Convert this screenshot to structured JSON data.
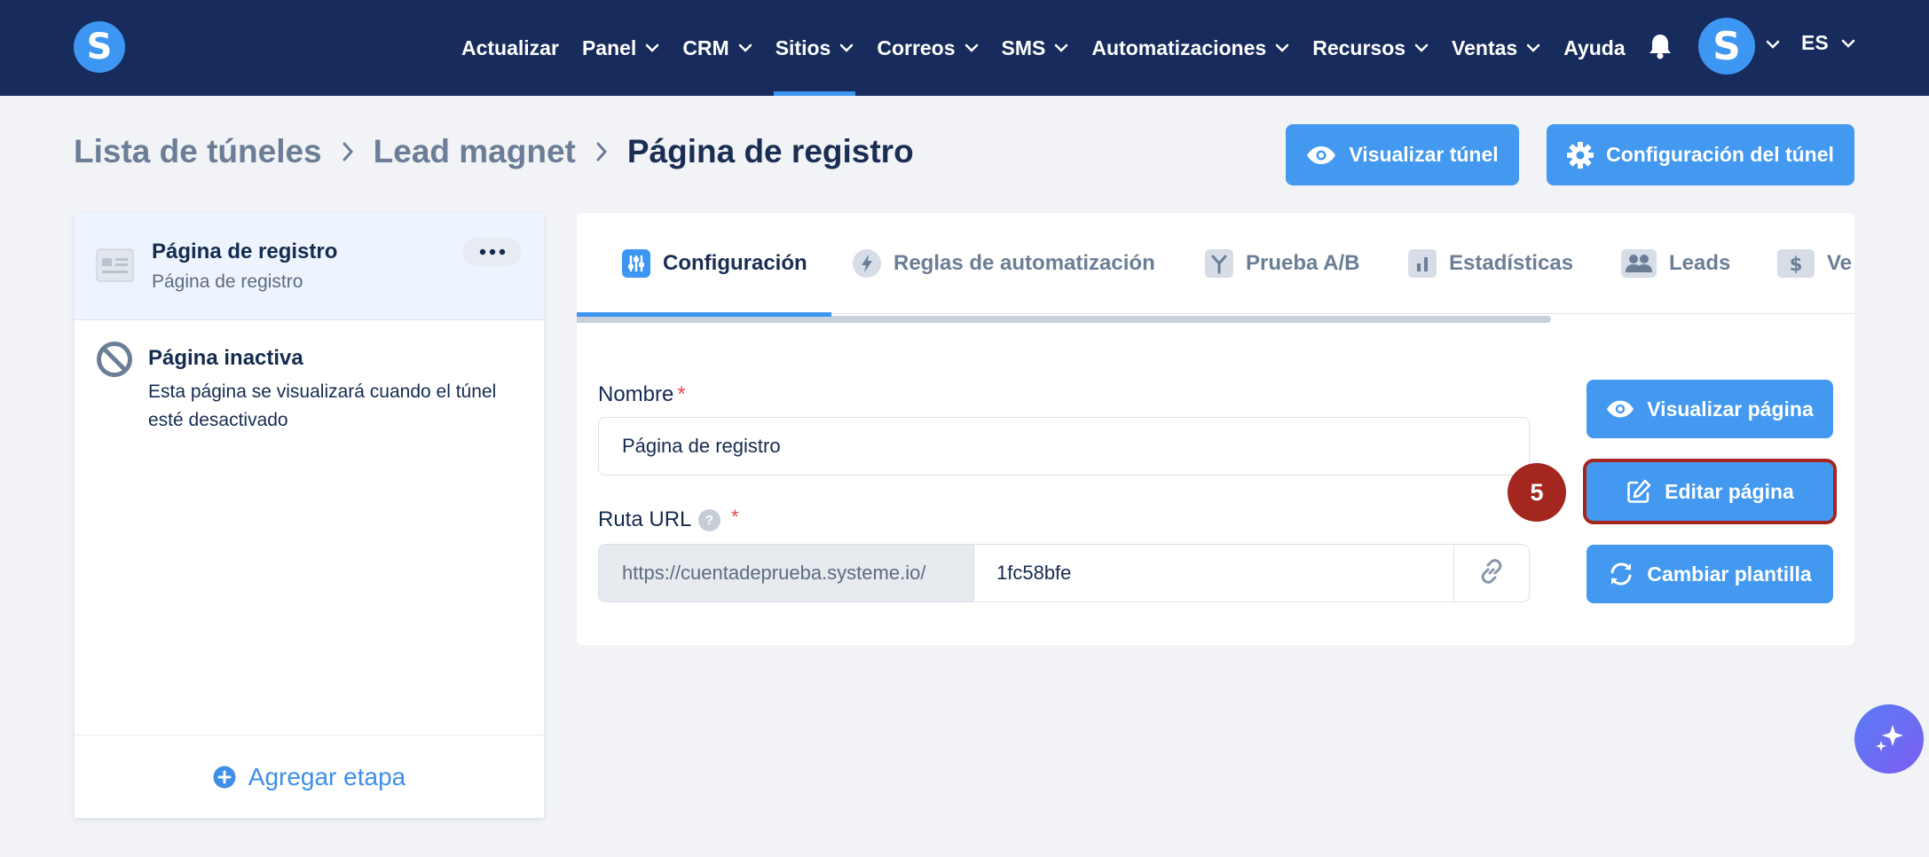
{
  "nav": {
    "logo_letter": "S",
    "items": [
      {
        "label": "Actualizar",
        "has_dropdown": false,
        "active": false
      },
      {
        "label": "Panel",
        "has_dropdown": true,
        "active": false
      },
      {
        "label": "CRM",
        "has_dropdown": true,
        "active": false
      },
      {
        "label": "Sitios",
        "has_dropdown": true,
        "active": true
      },
      {
        "label": "Correos",
        "has_dropdown": true,
        "active": false
      },
      {
        "label": "SMS",
        "has_dropdown": true,
        "active": false
      },
      {
        "label": "Automatizaciones",
        "has_dropdown": true,
        "active": false
      },
      {
        "label": "Recursos",
        "has_dropdown": true,
        "active": false
      },
      {
        "label": "Ventas",
        "has_dropdown": true,
        "active": false
      },
      {
        "label": "Ayuda",
        "has_dropdown": false,
        "active": false
      }
    ],
    "notification_icon": "bell-icon",
    "avatar_letter": "S",
    "language": "ES"
  },
  "breadcrumb": {
    "items": [
      "Lista de túneles",
      "Lead magnet"
    ],
    "current": "Página de registro"
  },
  "header_actions": {
    "preview_funnel": "Visualizar túnel",
    "funnel_settings": "Configuración del túnel"
  },
  "sidebar": {
    "active_step": {
      "title": "Página de registro",
      "subtitle": "Página de registro"
    },
    "inactive_page": {
      "title": "Página inactiva",
      "description": "Esta página se visualizará cuando el túnel esté desactivado"
    },
    "add_step_label": "Agregar etapa"
  },
  "tabs": [
    {
      "label": "Configuración",
      "icon": "sliders-icon",
      "active": true
    },
    {
      "label": "Reglas de automatización",
      "icon": "bolt-icon",
      "active": false
    },
    {
      "label": "Prueba A/B",
      "icon": "split-icon",
      "active": false
    },
    {
      "label": "Estadísticas",
      "icon": "bar-chart-icon",
      "active": false
    },
    {
      "label": "Leads",
      "icon": "users-icon",
      "active": false
    },
    {
      "label": "Ve",
      "icon": "dollar-icon",
      "active": false
    }
  ],
  "form": {
    "name_label": "Nombre",
    "name_value": "Página de registro",
    "url_label": "Ruta URL",
    "url_help": "?",
    "url_prefix": "https://cuentadeprueba.systeme.io/",
    "url_slug": "1fc58bfe",
    "required_mark": "*"
  },
  "page_actions": {
    "preview_page": "Visualizar página",
    "edit_page": "Editar página",
    "change_template": "Cambiar plantilla"
  },
  "annotation": {
    "step_number": "5"
  },
  "colors": {
    "nav_bg": "#172b5c",
    "accent": "#3c96f2",
    "button": "#4399f0",
    "highlight": "#a3271f"
  }
}
